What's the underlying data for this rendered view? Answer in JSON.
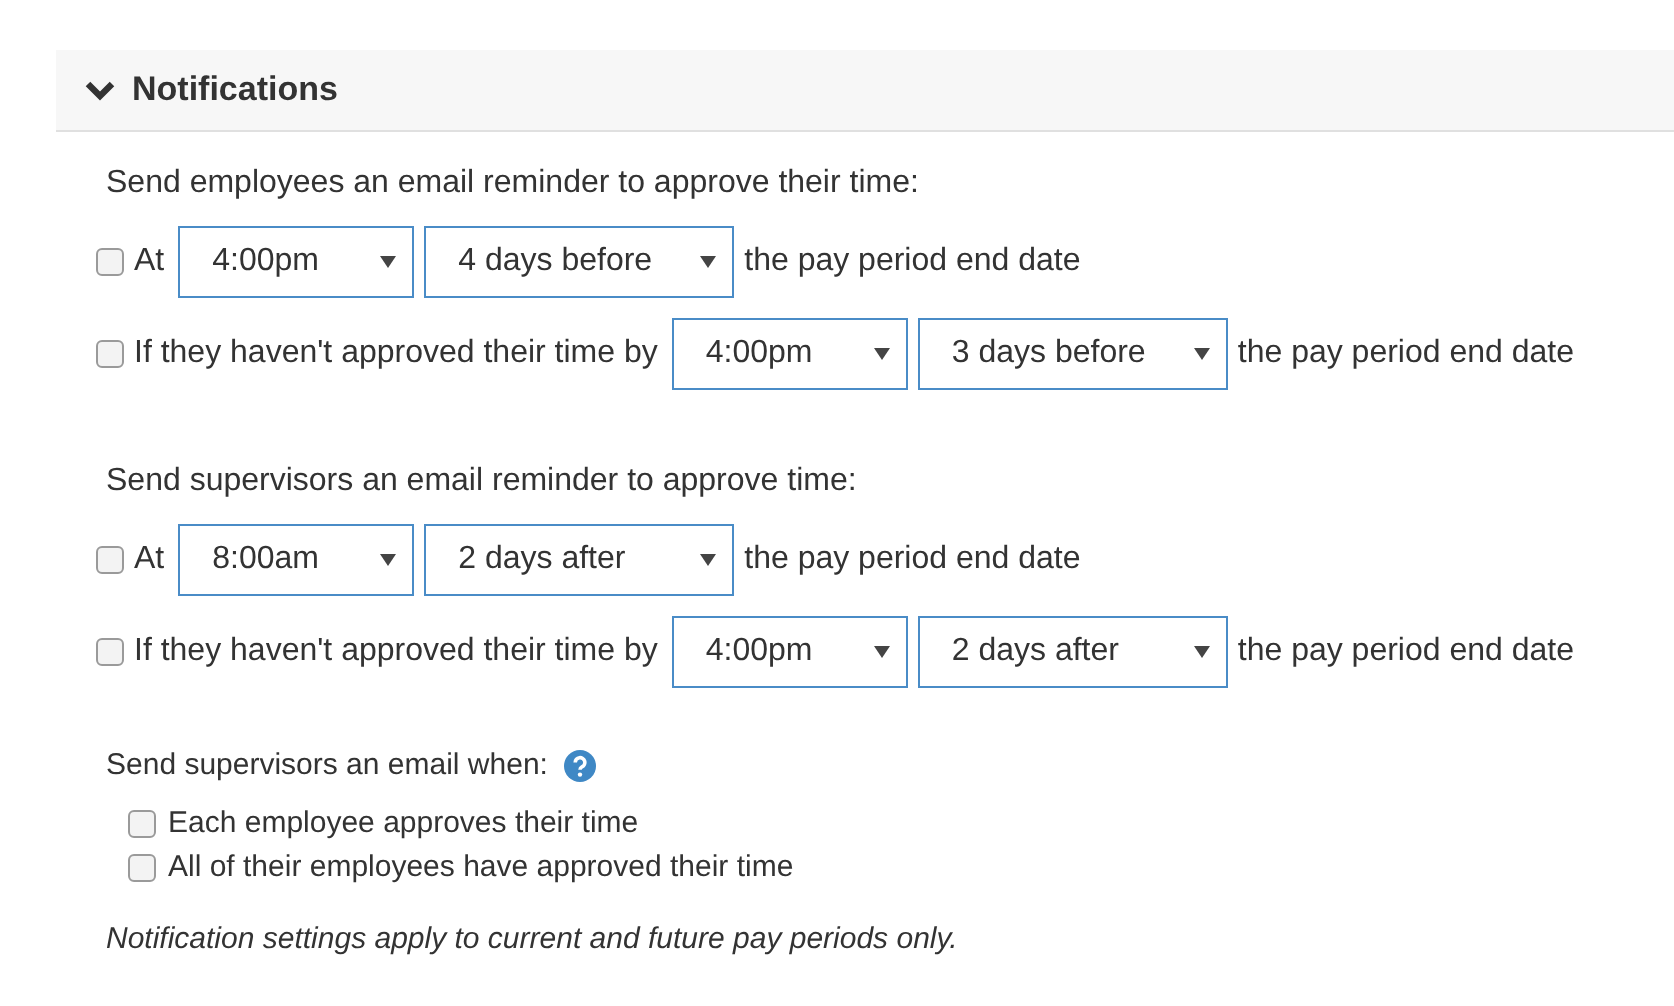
{
  "panel": {
    "title": "Notifications",
    "expanded": true
  },
  "reminder_groups": [
    {
      "heading": "Send employees an email reminder to approve their time:",
      "rows": [
        {
          "checked": false,
          "label": "At",
          "time": "4:00pm",
          "offset": "4 days before",
          "suffix": "the pay period end date"
        },
        {
          "checked": false,
          "label": "If they haven't approved their time by",
          "time": "4:00pm",
          "offset": "3 days before",
          "suffix": "the pay period end date"
        }
      ]
    },
    {
      "heading": "Send supervisors an email reminder to approve time:",
      "rows": [
        {
          "checked": false,
          "label": "At",
          "time": "8:00am",
          "offset": "2 days after",
          "suffix": "the pay period end date"
        },
        {
          "checked": false,
          "label": "If they haven't approved their time by",
          "time": "4:00pm",
          "offset": "2 days after",
          "suffix": "the pay period end date"
        }
      ]
    }
  ],
  "email_when": {
    "heading": "Send supervisors an email when:",
    "options": [
      {
        "label": "Each employee approves their time",
        "checked": false
      },
      {
        "label": "All of their employees have approved their time",
        "checked": false
      }
    ]
  },
  "note": "Notification settings apply to current and future pay periods only."
}
